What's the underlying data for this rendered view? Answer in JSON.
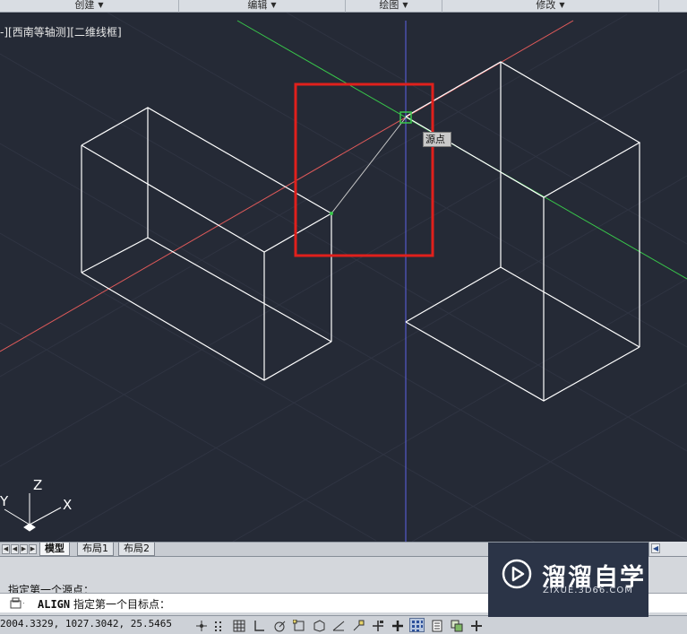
{
  "ribbon": {
    "panels": [
      {
        "label": "创建"
      },
      {
        "label": "编辑"
      },
      {
        "label": "绘图"
      },
      {
        "label": "修改"
      }
    ]
  },
  "viewport": {
    "label": "-][西南等轴测][二维线框]",
    "tooltip": "源点",
    "ucs": {
      "x": "X",
      "y": "Y",
      "z": "Z"
    },
    "colors": {
      "background": "#252a36",
      "wireframe": "#ffffff",
      "x_axis": "#e05a5a",
      "y_axis": "#38c64a",
      "z_axis": "#5d63e6",
      "highlight_box": "#e0201c"
    }
  },
  "layout_tabs": {
    "tabs": [
      {
        "label": "模型",
        "active": true
      },
      {
        "label": "布局1",
        "active": false
      },
      {
        "label": "布局2",
        "active": false
      }
    ]
  },
  "command": {
    "history_line": "指定第一个源点：",
    "input_command": "ALIGN",
    "input_prompt": "指定第一个目标点："
  },
  "status": {
    "coordinates": "2004.3329, 1027.3042, 25.5465",
    "buttons": [
      {
        "icon": "snap-icon",
        "on": false
      },
      {
        "icon": "grid-display-icon",
        "on": false
      },
      {
        "icon": "grid-icon",
        "on": false
      },
      {
        "icon": "ortho-icon",
        "on": false
      },
      {
        "icon": "polar-icon",
        "on": false
      },
      {
        "icon": "osnap-icon",
        "on": false
      },
      {
        "icon": "3d-osnap-icon",
        "on": false
      },
      {
        "icon": "otrack-icon",
        "on": false
      },
      {
        "icon": "ducs-icon",
        "on": false
      },
      {
        "icon": "dyn-icon",
        "on": false
      },
      {
        "icon": "lineweight-icon",
        "on": false
      },
      {
        "icon": "transparency-icon",
        "on": true
      },
      {
        "icon": "quick-properties-icon",
        "on": false
      },
      {
        "icon": "selection-cycling-icon",
        "on": false
      },
      {
        "icon": "annotation-monitor-icon",
        "on": false
      }
    ]
  },
  "watermark": {
    "title": "溜溜自学",
    "subtitle": "ZIXUE.3D66.COM"
  }
}
